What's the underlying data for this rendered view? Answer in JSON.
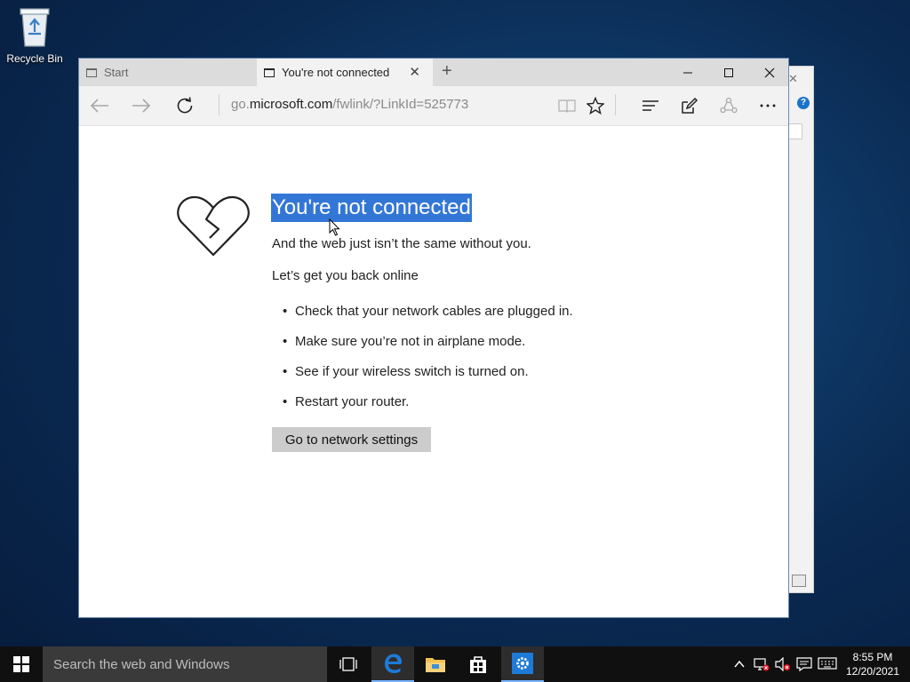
{
  "desktop": {
    "recycle_bin_label": "Recycle Bin"
  },
  "browser": {
    "tabs": [
      {
        "label": "Start",
        "active": false
      },
      {
        "label": "You're not connected",
        "active": true
      }
    ],
    "address": {
      "prefix": "go.",
      "host": "microsoft.com",
      "path": "/fwlink/?LinkId=525773"
    }
  },
  "page": {
    "title": "You're not connected",
    "subtitle": "And the web just isn’t the same without you.",
    "back_online": "Let’s get you back online",
    "tips": [
      "Check that your network cables are plugged in.",
      "Make sure you’re not in airplane mode.",
      "See if your wireless switch is turned on.",
      "Restart your router."
    ],
    "button_label": "Go to network settings"
  },
  "taskbar": {
    "search_placeholder": "Search the web and Windows",
    "time": "8:55 PM",
    "date": "12/20/2021"
  },
  "colors": {
    "selection": "#3377d6",
    "taskbar": "#101010",
    "edge_blue": "#1e7ad7"
  }
}
